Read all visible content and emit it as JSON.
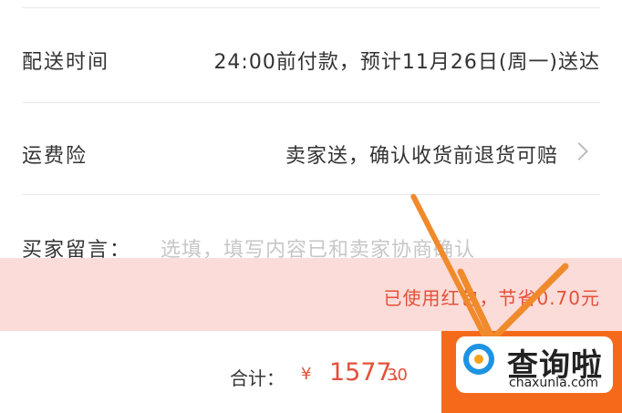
{
  "delivery": {
    "label": "配送时间",
    "value": "24:00前付款，预计11月26日(周一)送达"
  },
  "shipping_insurance": {
    "label": "运费险",
    "value": "卖家送，确认收货前退货可赔"
  },
  "buyer_message": {
    "label": "买家留言：",
    "placeholder": "选填，填写内容已和卖家协商确认"
  },
  "redpacket": {
    "text": "已使用红包，节省0.70元"
  },
  "summary": {
    "total_label": "合计：",
    "currency": "¥",
    "amount_int": "1577.",
    "amount_dec": "30"
  },
  "watermark": {
    "title": "查询啦",
    "subtitle": "chaxunla.com"
  },
  "colors": {
    "accent": "#e4503a",
    "submit": "#f56a1a",
    "redpacket_bg": "#fbdcd8",
    "arrow": "#f08a2b"
  }
}
